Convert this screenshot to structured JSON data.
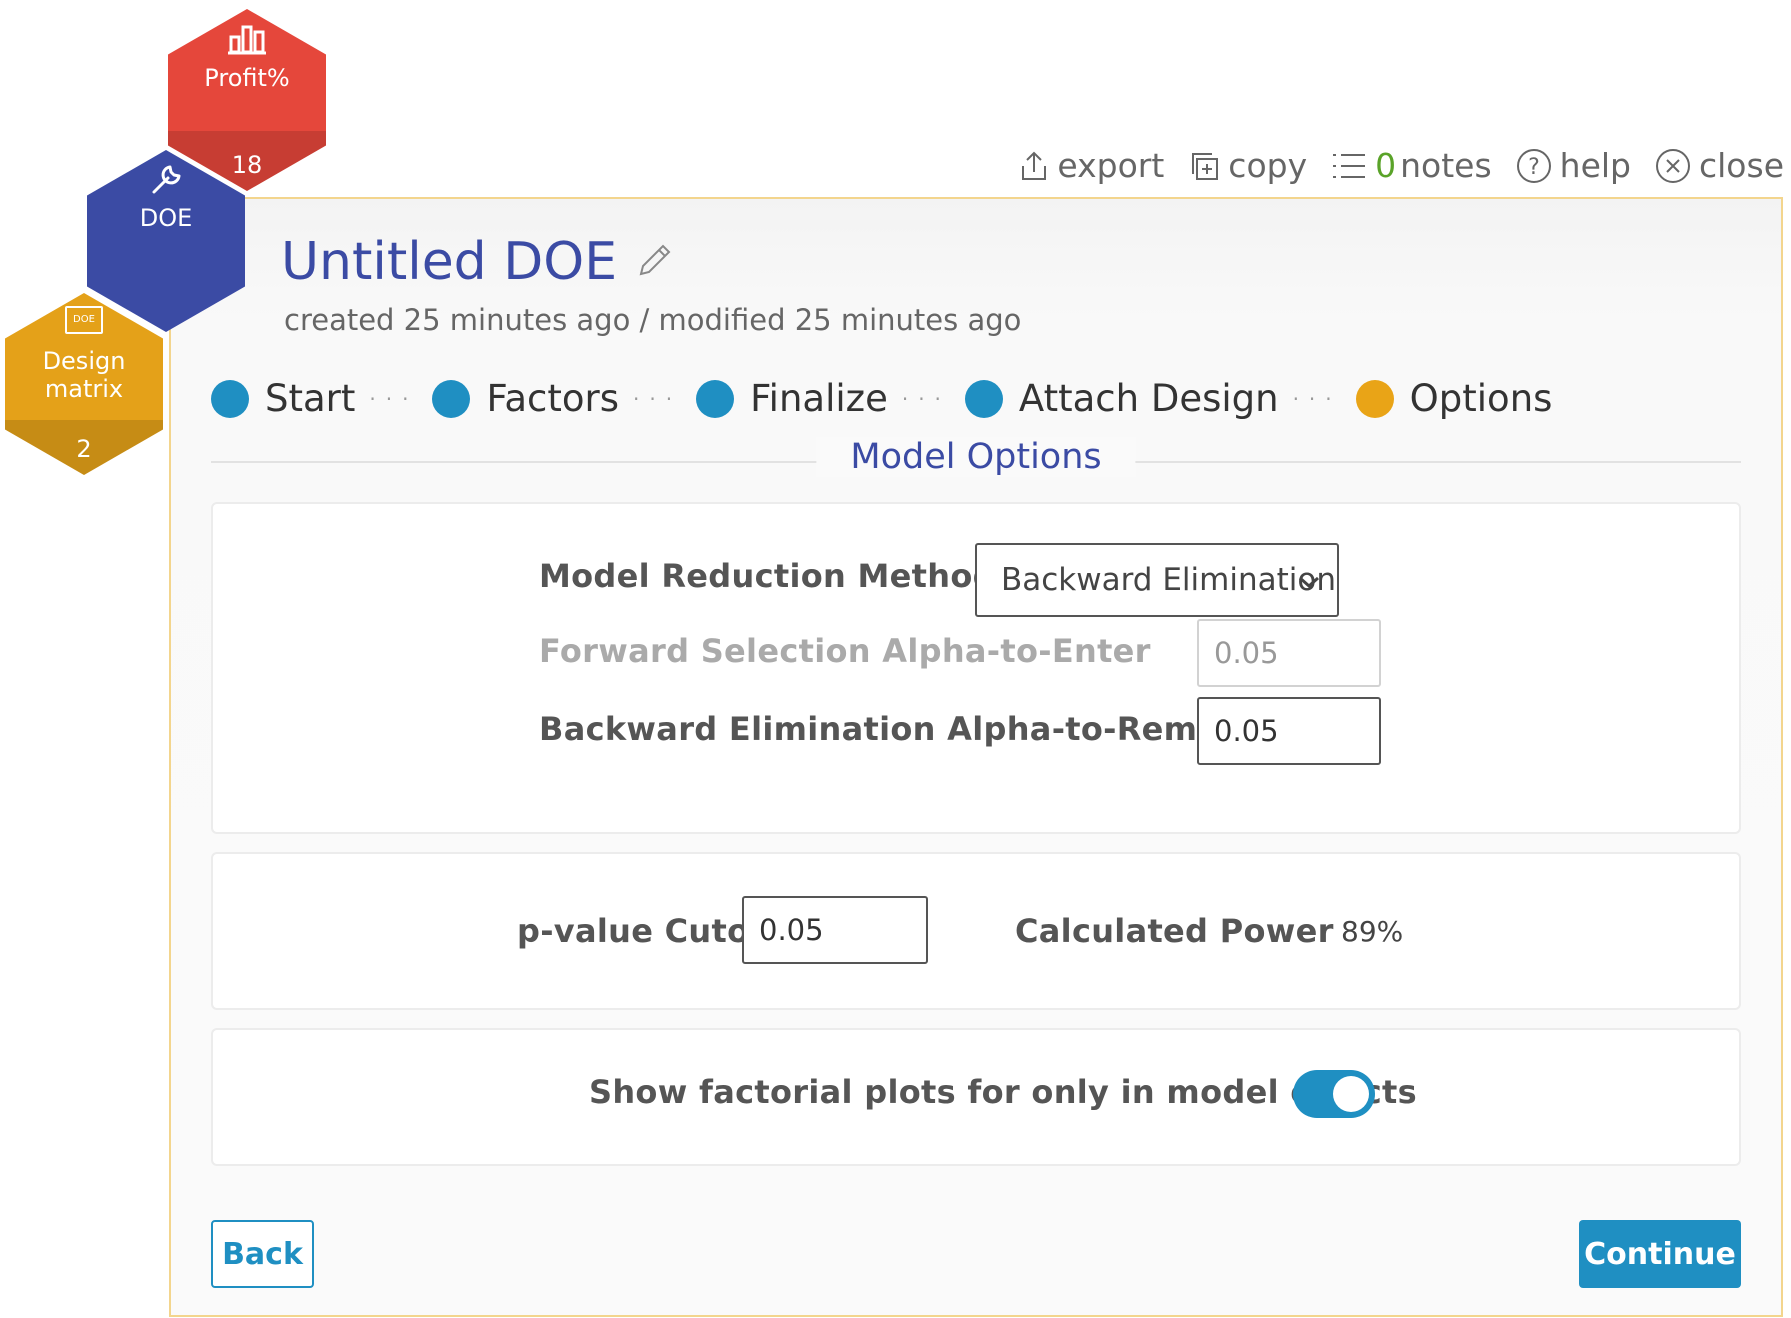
{
  "hexagons": {
    "profit": {
      "label": "Profit%",
      "count": "18",
      "color": "#e5473b",
      "icon": "bar-chart-icon"
    },
    "doe": {
      "label": "DOE",
      "color": "#3b4ba4",
      "icon": "wrench-icon"
    },
    "design": {
      "badge": "DOE",
      "label_line1": "Design",
      "label_line2": "matrix",
      "count": "2",
      "color": "#e4a119",
      "icon": "document-icon"
    }
  },
  "toolbar": {
    "export": "export",
    "copy": "copy",
    "notes_count": "0",
    "notes": "notes",
    "help": "help",
    "close": "close"
  },
  "header": {
    "title": "Untitled DOE",
    "subtitle": "created 25 minutes ago / modified 25 minutes ago"
  },
  "steps": [
    {
      "label": "Start",
      "state": "done"
    },
    {
      "label": "Factors",
      "state": "done"
    },
    {
      "label": "Finalize",
      "state": "done"
    },
    {
      "label": "Attach Design",
      "state": "done"
    },
    {
      "label": "Options",
      "state": "active"
    }
  ],
  "section_heading": "Model Options",
  "model_options": {
    "reduction_method_label": "Model Reduction Method",
    "reduction_method_value": "Backward Elimination",
    "forward_alpha_label": "Forward Selection Alpha-to-Enter",
    "forward_alpha_value": "0.05",
    "backward_alpha_label": "Backward Elimination Alpha-to-Remove",
    "backward_alpha_value": "0.05"
  },
  "pvalue": {
    "cutoff_label": "p-value Cutoff",
    "cutoff_value": "0.05",
    "power_label": "Calculated Power",
    "power_value": "89%"
  },
  "plots": {
    "toggle_label": "Show factorial plots for only in model effects",
    "toggle_on": true
  },
  "buttons": {
    "back": "Back",
    "continue": "Continue"
  },
  "colors": {
    "accent": "#1f8fc2",
    "title": "#3b4ba4",
    "active_step": "#e9a417",
    "panel_border": "#f3d58d"
  }
}
